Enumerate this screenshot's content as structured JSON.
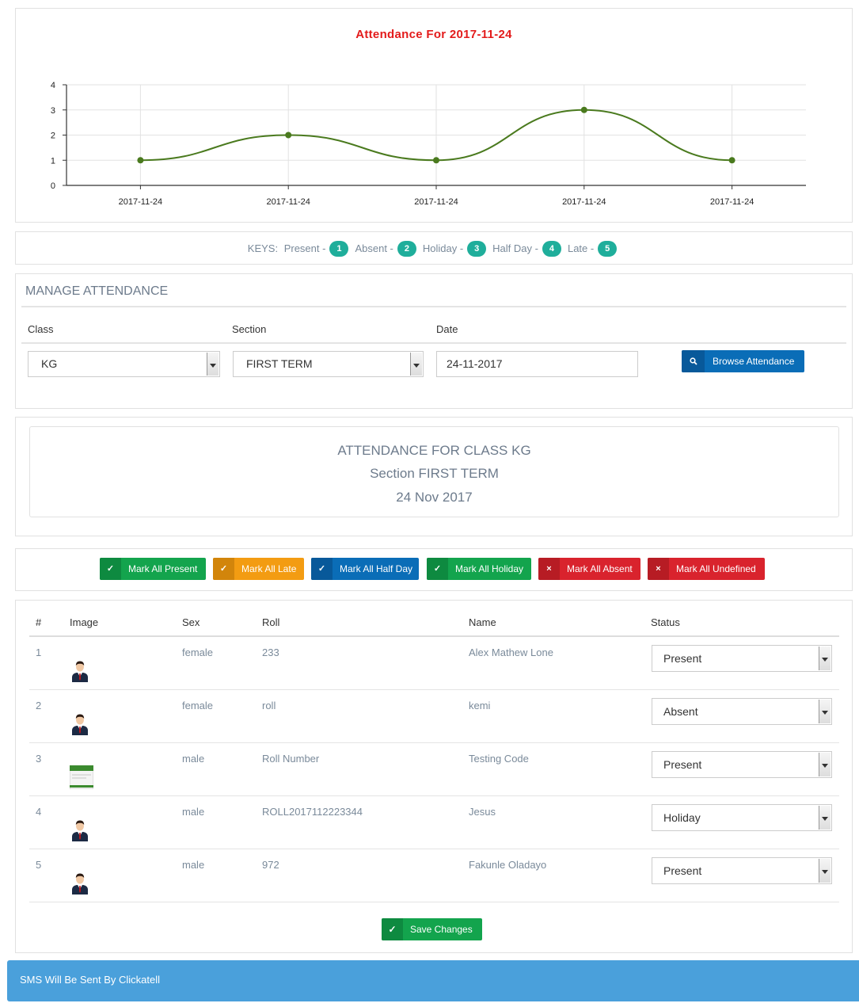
{
  "chart_data": {
    "type": "line",
    "title": "Attendance For 2017-11-24",
    "categories": [
      "2017-11-24",
      "2017-11-24",
      "2017-11-24",
      "2017-11-24",
      "2017-11-24"
    ],
    "values": [
      1,
      2,
      1,
      3,
      1
    ],
    "ylim": [
      0,
      4
    ],
    "yticks": [
      "0",
      "1",
      "2",
      "3",
      "4"
    ],
    "grid": true,
    "line_color": "#4a7a1e",
    "title_color": "#e31b1b"
  },
  "keys": {
    "prefix": "KEYS:",
    "items": [
      {
        "label": "Present -",
        "code": "1"
      },
      {
        "label": "Absent -",
        "code": "2"
      },
      {
        "label": "Holiday -",
        "code": "3"
      },
      {
        "label": "Half Day -",
        "code": "4"
      },
      {
        "label": "Late -",
        "code": "5"
      }
    ]
  },
  "manage": {
    "title": "MANAGE ATTENDANCE",
    "class_label": "Class",
    "section_label": "Section",
    "date_label": "Date",
    "class_value": "KG",
    "section_value": "FIRST TERM",
    "date_value": "24-11-2017",
    "browse_label": "Browse Attendance"
  },
  "summary": {
    "line1": "ATTENDANCE FOR CLASS KG",
    "line2": "Section FIRST TERM",
    "line3": "24 Nov 2017"
  },
  "mark_buttons": [
    {
      "label": "Mark All Present",
      "icon": "✓",
      "color": "#13a44d",
      "dark": "#0e8a40"
    },
    {
      "label": "Mark All Late",
      "icon": "✓",
      "color": "#f39c12",
      "dark": "#d2850b"
    },
    {
      "label": "Mark All Half Day",
      "icon": "✓",
      "color": "#0a6db7",
      "dark": "#08599a"
    },
    {
      "label": "Mark All Holiday",
      "icon": "✓",
      "color": "#13a44d",
      "dark": "#0e8a40"
    },
    {
      "label": "Mark All Absent",
      "icon": "×",
      "color": "#d9232d",
      "dark": "#b71c24"
    },
    {
      "label": "Mark All Undefined",
      "icon": "×",
      "color": "#d9232d",
      "dark": "#b71c24"
    }
  ],
  "table": {
    "headers": {
      "num": "#",
      "image": "Image",
      "sex": "Sex",
      "roll": "Roll",
      "name": "Name",
      "status": "Status"
    },
    "rows": [
      {
        "num": "1",
        "sex": "female",
        "roll": "233",
        "name": "Alex Mathew Lone",
        "status": "Present",
        "image": "person-avatar"
      },
      {
        "num": "2",
        "sex": "female",
        "roll": "roll",
        "name": "kemi",
        "status": "Absent",
        "image": "person-avatar"
      },
      {
        "num": "3",
        "sex": "male",
        "roll": "Roll Number",
        "name": "Testing Code",
        "status": "Present",
        "image": "photo-thumbnail"
      },
      {
        "num": "4",
        "sex": "male",
        "roll": "ROLL2017112223344",
        "name": "Jesus",
        "status": "Holiday",
        "image": "person-avatar"
      },
      {
        "num": "5",
        "sex": "male",
        "roll": "972",
        "name": "Fakunle Oladayo",
        "status": "Present",
        "image": "person-avatar"
      }
    ],
    "save_label": "Save Changes"
  },
  "footer": {
    "sms_text": "SMS Will Be Sent By Clickatell"
  }
}
